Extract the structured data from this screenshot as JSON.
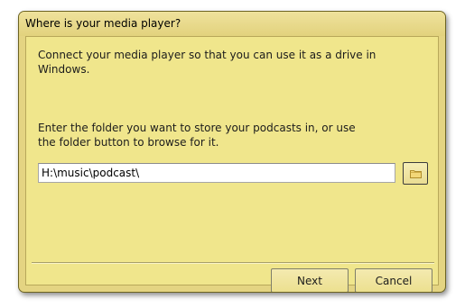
{
  "dialog": {
    "title": "Where is your media player?",
    "intro_line1": "Connect your media player so that you can use it as a drive in",
    "intro_line2": "Windows.",
    "folder_prompt_line1": "Enter the folder you want to store your podcasts in, or use",
    "folder_prompt_line2": "the folder button to browse for it.",
    "folder_path": "H:\\music\\podcast\\",
    "browse_icon": "folder-icon",
    "next_label": "Next",
    "cancel_label": "Cancel"
  },
  "colors": {
    "window_frame": "#e4d482",
    "client_background": "#f0e68c"
  }
}
